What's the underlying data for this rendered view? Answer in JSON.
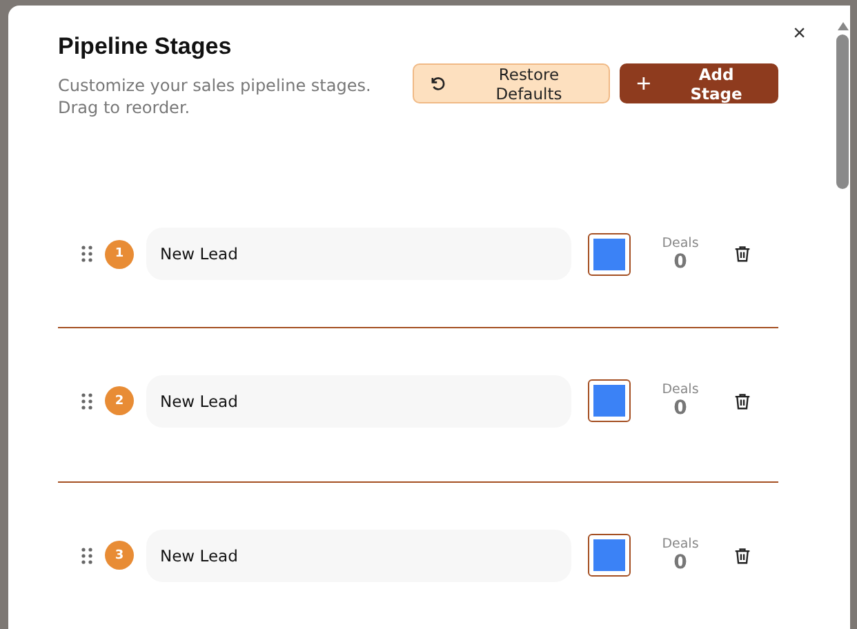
{
  "dialog": {
    "title": "Pipeline Stages",
    "description": "Customize your sales pipeline stages. Drag to reorder.",
    "close": "×"
  },
  "buttons": [
    {
      "kind": "secondary",
      "label": "Restore Defaults"
    },
    {
      "kind": "primary",
      "label": "Add Stage"
    }
  ],
  "stages": [
    {
      "number": "1",
      "name": "New Lead",
      "color": "#3b82f6",
      "deals_label": "Deals",
      "deals": "0"
    },
    {
      "number": "2",
      "name": "New Lead",
      "color": "#3b82f6",
      "deals_label": "Deals",
      "deals": "0"
    },
    {
      "number": "3",
      "name": "New Lead",
      "color": "#3b82f6",
      "deals_label": "Deals",
      "deals": "0"
    }
  ]
}
